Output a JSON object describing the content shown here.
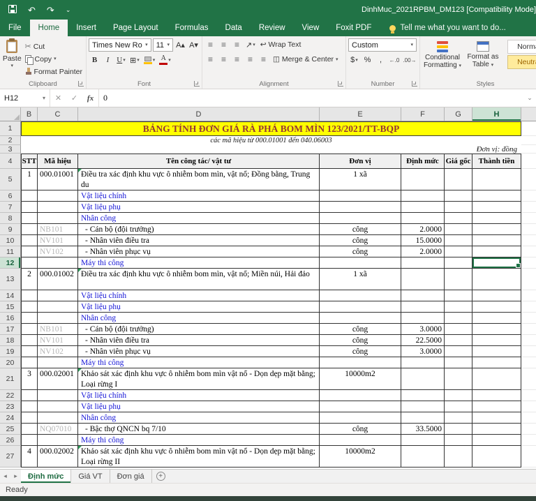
{
  "icons": {
    "caret_down": "▾",
    "caret_small": "⌄",
    "undo": "↶",
    "redo": "↷",
    "cut": "✂",
    "close": "✕",
    "check": "✓",
    "fx": "fx",
    "bold": "B",
    "italic": "I",
    "underline": "U",
    "grow_font": "A▴",
    "shrink_font": "A▾",
    "borders": "⊞",
    "font_color": "A",
    "align_lines": "≡",
    "orientation": "↗",
    "wrap": "↩",
    "merge": "◫",
    "dollar": "$",
    "percent": "%",
    "comma": ",",
    "increase_decimal": "←.0",
    "decrease_decimal": ".00→",
    "tab_left": "◂",
    "tab_right": "▸",
    "plus": "+"
  },
  "titlebar": {
    "title": "DinhMuc_2021RPBM_DM123  [Compatibility Mode]"
  },
  "ribbon": {
    "tabs": [
      "File",
      "Home",
      "Insert",
      "Page Layout",
      "Formulas",
      "Data",
      "Review",
      "View",
      "Foxit PDF"
    ],
    "active_tab": "Home",
    "tell_me": "Tell me what you want to do...",
    "clipboard": {
      "label": "Clipboard",
      "paste": "Paste",
      "cut": "Cut",
      "copy": "Copy",
      "format_painter": "Format Painter"
    },
    "font": {
      "label": "Font",
      "name": "Times New Ro",
      "size": "11"
    },
    "alignment": {
      "label": "Alignment",
      "wrap_text": "Wrap Text",
      "merge_center": "Merge & Center"
    },
    "number": {
      "label": "Number",
      "format": "Custom"
    },
    "styles": {
      "label": "Styles",
      "conditional_formatting": "Conditional Formatting",
      "format_as_table": "Format as Table",
      "cell_styles": [
        "Normal",
        "Neutral"
      ]
    }
  },
  "formula_bar": {
    "name_box": "H12",
    "value": "0"
  },
  "sheet": {
    "columns": [
      "B",
      "C",
      "D",
      "E",
      "F",
      "G",
      "H"
    ],
    "selected_col": "H",
    "selected_row": 12,
    "title": "BẢNG TÍNH ĐƠN GIÁ RÀ PHÁ BOM MÌN 123/2021/TT-BQP",
    "subtitle": "các mã hiệu từ 000.01001 đến 040.06003",
    "unit_note": "Đơn vị: đồng",
    "headers": [
      "STT",
      "Mã hiệu",
      "Tên công tác/ vật tư",
      "Đơn vị",
      "Định mức",
      "Giá gốc",
      "Thành tiền"
    ],
    "rows": [
      {
        "n": 5,
        "stt": "1",
        "code": "000.01001",
        "name": "Điều tra xác định khu vực ô nhiễm bom mìn, vật nổ; Đồng bằng, Trung du",
        "unit": "1 xã",
        "tall": true,
        "marker": true
      },
      {
        "n": 6,
        "name": "Vật liệu chính",
        "cat": true
      },
      {
        "n": 7,
        "name": "Vật liệu phụ",
        "cat": true
      },
      {
        "n": 8,
        "name": "Nhân công",
        "cat": true
      },
      {
        "n": 9,
        "code": "NB101",
        "gray": true,
        "name": "- Cán bộ (đội trưởng)",
        "unit": "công",
        "qty": "2.0000"
      },
      {
        "n": 10,
        "code": "NV101",
        "gray": true,
        "name": "- Nhân viên điều tra",
        "unit": "công",
        "qty": "15.0000"
      },
      {
        "n": 11,
        "code": "NV102",
        "gray": true,
        "name": "- Nhân viên phục vụ",
        "unit": "công",
        "qty": "2.0000"
      },
      {
        "n": 12,
        "name": "Máy thi công",
        "cat": true
      },
      {
        "n": 13,
        "stt": "2",
        "code": "000.01002",
        "name": "Điều tra xác định khu vực ô nhiễm bom mìn, vật nổ; Miền núi, Hải đảo",
        "unit": "1 xã",
        "tall": true,
        "marker": true
      },
      {
        "n": 14,
        "name": "Vật liệu chính",
        "cat": true
      },
      {
        "n": 15,
        "name": "Vật liệu phụ",
        "cat": true
      },
      {
        "n": 16,
        "name": "Nhân công",
        "cat": true
      },
      {
        "n": 17,
        "code": "NB101",
        "gray": true,
        "name": "- Cán bộ (đội trưởng)",
        "unit": "công",
        "qty": "3.0000"
      },
      {
        "n": 18,
        "code": "NV101",
        "gray": true,
        "name": "- Nhân viên điều tra",
        "unit": "công",
        "qty": "22.5000"
      },
      {
        "n": 19,
        "code": "NV102",
        "gray": true,
        "name": "- Nhân viên phục vụ",
        "unit": "công",
        "qty": "3.0000"
      },
      {
        "n": 20,
        "name": "Máy thi công",
        "cat": true
      },
      {
        "n": 21,
        "stt": "3",
        "code": "000.02001",
        "name": "Khảo sát xác định khu vực ô nhiễm bom mìn vật nổ - Dọn dẹp mặt bằng; Loại rừng I",
        "unit": "10000m2",
        "tall": true,
        "marker": true
      },
      {
        "n": 22,
        "name": "Vật liệu chính",
        "cat": true
      },
      {
        "n": 23,
        "name": "Vật liệu phụ",
        "cat": true
      },
      {
        "n": 24,
        "name": "Nhân công",
        "cat": true
      },
      {
        "n": 25,
        "code": "NQ07010",
        "gray": true,
        "name": "- Bậc thợ QNCN bq 7/10",
        "unit": "công",
        "qty": "33.5000"
      },
      {
        "n": 26,
        "name": "Máy thi công",
        "cat": true
      },
      {
        "n": 27,
        "stt": "4",
        "code": "000.02002",
        "name": "Khảo sát xác định khu vực ô nhiễm bom mìn vật nổ - Dọn dẹp mặt bằng; Loại rừng II",
        "unit": "10000m2",
        "tall": true,
        "marker": true
      }
    ]
  },
  "sheet_tabs": {
    "tabs": [
      "Định mức",
      "Giá VT",
      "Đơn giá"
    ],
    "active": "Định mức"
  },
  "status_bar": {
    "text": "Ready"
  }
}
